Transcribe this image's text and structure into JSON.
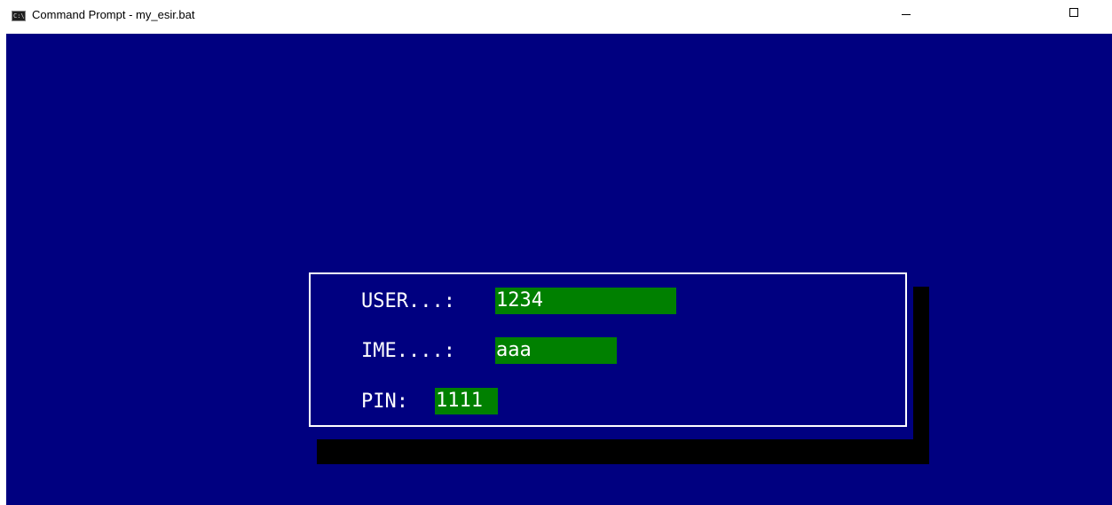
{
  "window": {
    "title": "Command Prompt - my_esir.bat",
    "icon": "cmd-icon",
    "icon_text": "C:\\",
    "controls": [
      "minimize-icon",
      "maximize-icon"
    ]
  },
  "colors": {
    "console_bg": "#000080",
    "field_bg": "#008000",
    "text": "#ffffff",
    "shadow": "#000000"
  },
  "form": {
    "user_label": "USER...:",
    "user_value": "1234",
    "ime_label": "IME....:",
    "ime_value": "aaa",
    "pin_label": "PIN:",
    "pin_value": "1111"
  }
}
